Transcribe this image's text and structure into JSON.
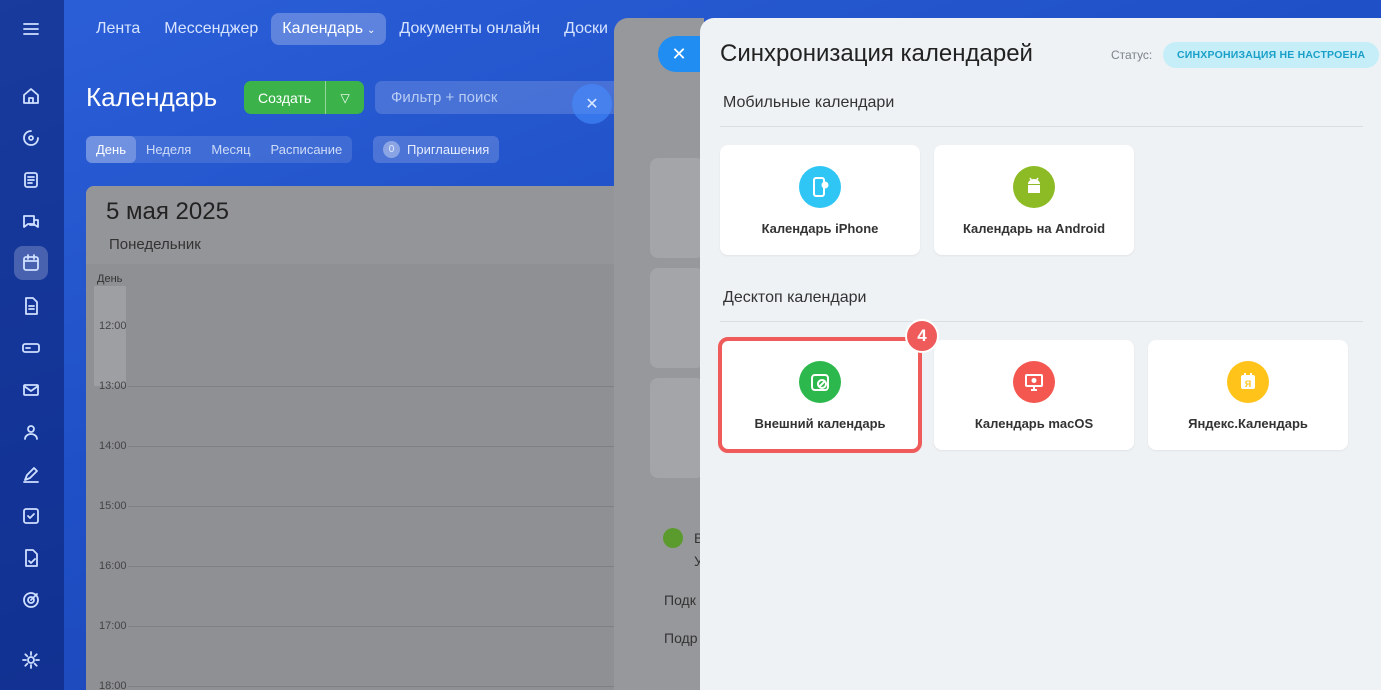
{
  "topnav": {
    "tabs": [
      {
        "label": "Лента",
        "active": false
      },
      {
        "label": "Мессенджер",
        "active": false
      },
      {
        "label": "Календарь",
        "active": true
      },
      {
        "label": "Документы онлайн",
        "active": false
      },
      {
        "label": "Доски",
        "active": false
      }
    ]
  },
  "calendar": {
    "title": "Календарь",
    "create_label": "Создать",
    "filter_placeholder": "Фильтр + поиск",
    "views": [
      {
        "label": "День",
        "active": true
      },
      {
        "label": "Неделя",
        "active": false
      },
      {
        "label": "Месяц",
        "active": false
      },
      {
        "label": "Расписание",
        "active": false
      }
    ],
    "invites": {
      "count": "0",
      "label": "Приглашения"
    },
    "date": "5 мая 2025",
    "weekday": "Понедельник",
    "day_label": "День",
    "hours": [
      "12:00",
      "13:00",
      "14:00",
      "15:00",
      "16:00",
      "17:00",
      "18:00"
    ]
  },
  "middle": {
    "text1": "В",
    "text2": "У",
    "link1": "Подк",
    "link2": "Подр"
  },
  "panel": {
    "title": "Синхронизация календарей",
    "status_label": "Статус:",
    "status_value": "СИНХРОНИЗАЦИЯ НЕ НАСТРОЕНА",
    "mobile_section": "Мобильные календари",
    "desktop_section": "Десктоп календари",
    "mobile_tiles": [
      {
        "label": "Календарь iPhone",
        "icon": "iphone-icon",
        "color": "#2fc6f6"
      },
      {
        "label": "Календарь на Android",
        "icon": "android-icon",
        "color": "#8dbb25"
      }
    ],
    "desktop_tiles": [
      {
        "label": "Внешний календарь",
        "icon": "external-calendar-icon",
        "color": "#2db84d",
        "highlighted": true
      },
      {
        "label": "Календарь macOS",
        "icon": "macos-icon",
        "color": "#f4574f",
        "highlighted": false
      },
      {
        "label": "Яндекс.Календарь",
        "icon": "yandex-calendar-icon",
        "color": "#ffc31a",
        "highlighted": false
      }
    ],
    "step_number": "4"
  },
  "colors": {
    "accent_blue": "#1f8df2",
    "create_green": "#3bb34a",
    "highlight_red": "#ef5b5b"
  }
}
